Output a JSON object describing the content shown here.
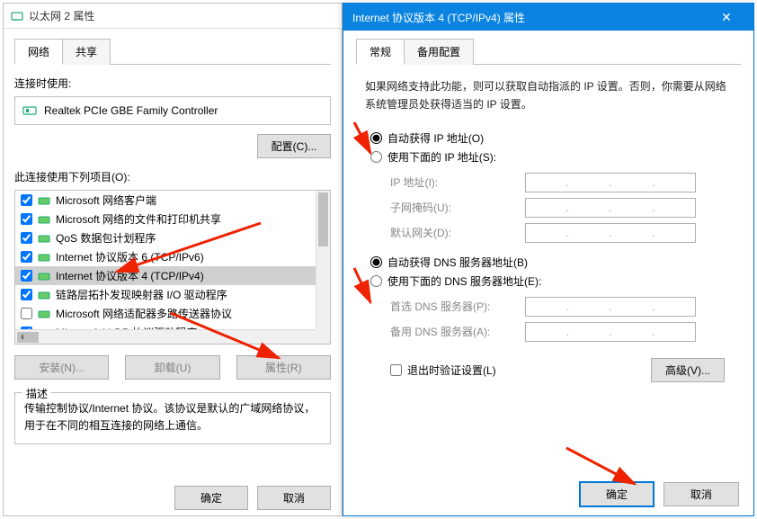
{
  "left": {
    "title": "以太网 2 属性",
    "tabs": {
      "network": "网络",
      "share": "共享"
    },
    "connect_label": "连接时使用:",
    "adapter": "Realtek PCIe GBE Family Controller",
    "configure_btn": "配置(C)...",
    "items_label": "此连接使用下列项目(O):",
    "items": [
      {
        "checked": true,
        "label": "Microsoft 网络客户端"
      },
      {
        "checked": true,
        "label": "Microsoft 网络的文件和打印机共享"
      },
      {
        "checked": true,
        "label": "QoS 数据包计划程序"
      },
      {
        "checked": true,
        "label": "Internet 协议版本 6 (TCP/IPv6)"
      },
      {
        "checked": true,
        "label": "Internet 协议版本 4 (TCP/IPv4)",
        "selected": true
      },
      {
        "checked": true,
        "label": "链路层拓扑发现映射器 I/O 驱动程序"
      },
      {
        "checked": false,
        "label": "Microsoft 网络适配器多路传送器协议"
      },
      {
        "checked": true,
        "label": "Microsoft LLDP 协议驱动程序"
      }
    ],
    "install_btn": "安装(N)...",
    "uninstall_btn": "卸载(U)",
    "properties_btn": "属性(R)",
    "desc_legend": "描述",
    "desc_text": "传输控制协议/Internet 协议。该协议是默认的广域网络协议，用于在不同的相互连接的网络上通信。",
    "ok_btn": "确定",
    "cancel_btn": "取消"
  },
  "right": {
    "title": "Internet 协议版本 4 (TCP/IPv4) 属性",
    "tabs": {
      "general": "常规",
      "alt": "备用配置"
    },
    "info": "如果网络支持此功能，则可以获取自动指派的 IP 设置。否则，你需要从网络系统管理员处获得适当的 IP 设置。",
    "ip_auto": "自动获得 IP 地址(O)",
    "ip_manual": "使用下面的 IP 地址(S):",
    "ip_addr_label": "IP 地址(I):",
    "subnet_label": "子网掩码(U):",
    "gateway_label": "默认网关(D):",
    "dns_auto": "自动获得 DNS 服务器地址(B)",
    "dns_manual": "使用下面的 DNS 服务器地址(E):",
    "dns_pref_label": "首选 DNS 服务器(P):",
    "dns_alt_label": "备用 DNS 服务器(A):",
    "validate_label": "退出时验证设置(L)",
    "advanced_btn": "高级(V)...",
    "ok_btn": "确定",
    "cancel_btn": "取消"
  }
}
